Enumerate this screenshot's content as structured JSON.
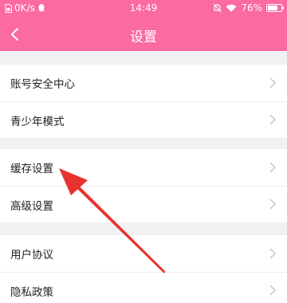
{
  "status_bar": {
    "speed": "0K/s",
    "time": "14:49",
    "battery": "76%",
    "battery_level": 0.76,
    "icons": [
      "sim-icon",
      "qq-icon",
      "mute-icon",
      "wifi-icon",
      "battery-icon"
    ]
  },
  "header": {
    "back_icon": "chevron-left-icon",
    "title": "设置"
  },
  "groups": [
    {
      "items": [
        {
          "label": "账号安全中心"
        },
        {
          "label": "青少年模式"
        }
      ]
    },
    {
      "items": [
        {
          "label": "缓存设置"
        },
        {
          "label": "高级设置"
        }
      ]
    },
    {
      "items": [
        {
          "label": "用户协议"
        },
        {
          "label": "隐私政策"
        }
      ]
    }
  ],
  "annotation": {
    "type": "red-arrow",
    "color": "#e8322e",
    "points_to": "缓存设置"
  },
  "colors": {
    "accent": "#fb6aa0",
    "background": "#f1f1f3",
    "chevron": "#c4c4c4"
  }
}
